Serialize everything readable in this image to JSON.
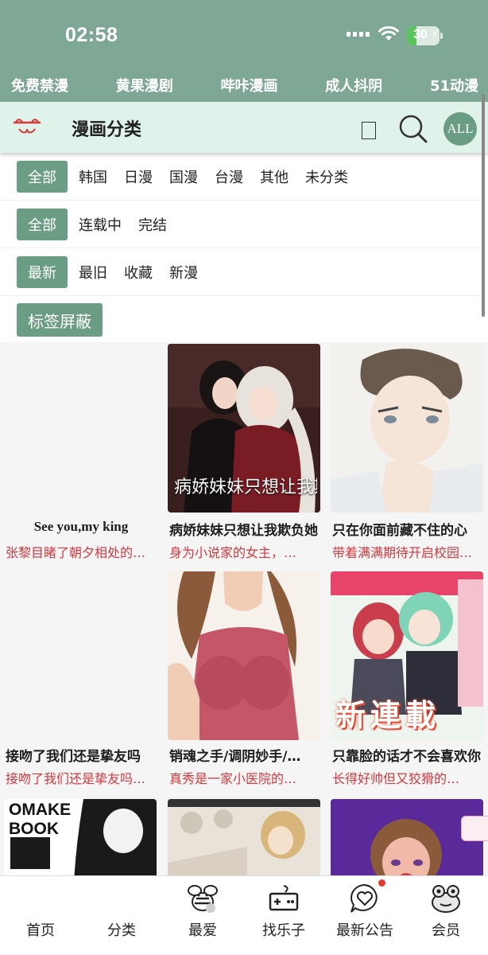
{
  "status_bar": {
    "time": "02:58",
    "battery": "30",
    "battery_level": 0.3
  },
  "promo_links": [
    "免费禁漫",
    "黄果漫剧",
    "哔咔漫画",
    "成人抖阴",
    "51动漫"
  ],
  "header": {
    "title": "漫画分类",
    "all_button": "ALL"
  },
  "filters": {
    "region": {
      "active": "全部",
      "options": [
        "韩国",
        "日漫",
        "国漫",
        "台漫",
        "其他",
        "未分类"
      ]
    },
    "status": {
      "active": "全部",
      "options": [
        "连载中",
        "完结"
      ]
    },
    "sort": {
      "active": "最新",
      "options": [
        "最旧",
        "收藏",
        "新漫"
      ]
    },
    "tag_block_label": "标签屏蔽"
  },
  "comics": [
    {
      "title": "See you,my king",
      "desc": "张黎目睹了朝夕相处的…"
    },
    {
      "title": "病娇妹妹只想让我欺负她",
      "desc": "身为小说家的女主，…",
      "cover_text": "病娇妹妹只想让我欺负她"
    },
    {
      "title": "只在你面前藏不住的心",
      "desc": "带着满满期待开启校园…"
    },
    {
      "title": "接吻了我们还是挚友吗",
      "desc": "接吻了我们还是挚友吗…"
    },
    {
      "title": "销魂之手/调阴妙手/…",
      "desc": "真秀是一家小医院的…"
    },
    {
      "title": "只靠脸的话才不会喜欢你",
      "desc": "长得好帅但又狡猾的…",
      "cover_text": "新連載"
    },
    {
      "title": "",
      "desc": "",
      "cover_text": "OMAKE BOOK"
    },
    {
      "title": "",
      "desc": ""
    },
    {
      "title": "",
      "desc": ""
    }
  ],
  "tabs": [
    {
      "label": "首页",
      "icon": "home-icon"
    },
    {
      "label": "分类",
      "icon": "category-icon"
    },
    {
      "label": "最爱",
      "icon": "bee-icon"
    },
    {
      "label": "找乐子",
      "icon": "gamepad-icon"
    },
    {
      "label": "最新公告",
      "icon": "heart-chat-icon"
    },
    {
      "label": "会员",
      "icon": "frog-icon"
    }
  ]
}
